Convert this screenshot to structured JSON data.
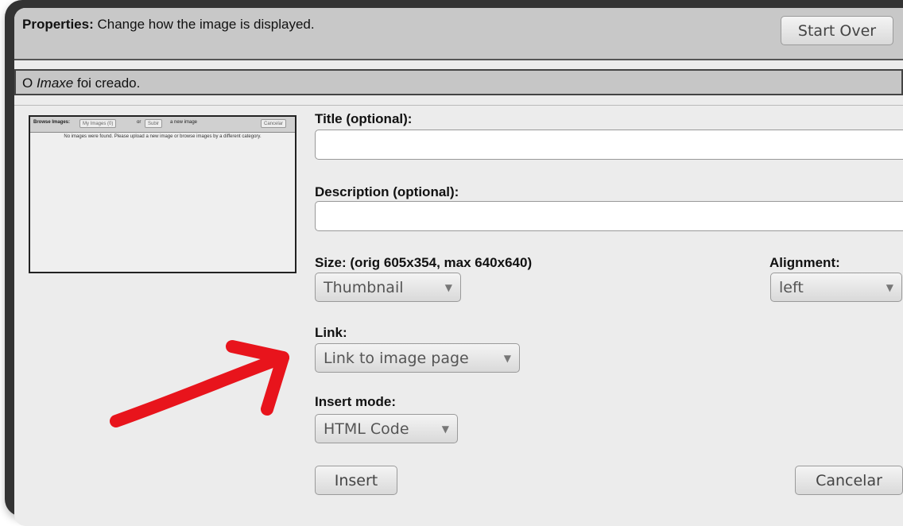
{
  "header": {
    "title_bold": "Properties:",
    "title_rest": " Change how the image is displayed.",
    "start_over_label": "Start Over"
  },
  "status": {
    "prefix": "O ",
    "emphasis": "Imaxe",
    "suffix": " foi creado."
  },
  "preview": {
    "browse_label": "Browse Images:",
    "category_value": "My Images (0)",
    "or_text": "or",
    "upload_button": "Subir",
    "new_image_text": "a new image",
    "cancel_button": "Cancelar",
    "message": "No images were found. Please upload a new image or browse images by a different category."
  },
  "form": {
    "title_label": "Title (optional):",
    "title_value": "",
    "description_label": "Description (optional):",
    "description_value": "",
    "size_label": "Size: (orig 605x354, max 640x640)",
    "size_value": "Thumbnail",
    "alignment_label": "Alignment:",
    "alignment_value": "left",
    "link_label": "Link:",
    "link_value": "Link to image page",
    "insert_mode_label": "Insert mode:",
    "insert_mode_value": "HTML Code",
    "insert_button": "Insert",
    "cancel_button": "Cancelar"
  },
  "annotation": {
    "arrow_color": "#e8141c"
  },
  "icons": {
    "dropdown": "dropdown-arrow-icon",
    "glyph": "▼"
  }
}
